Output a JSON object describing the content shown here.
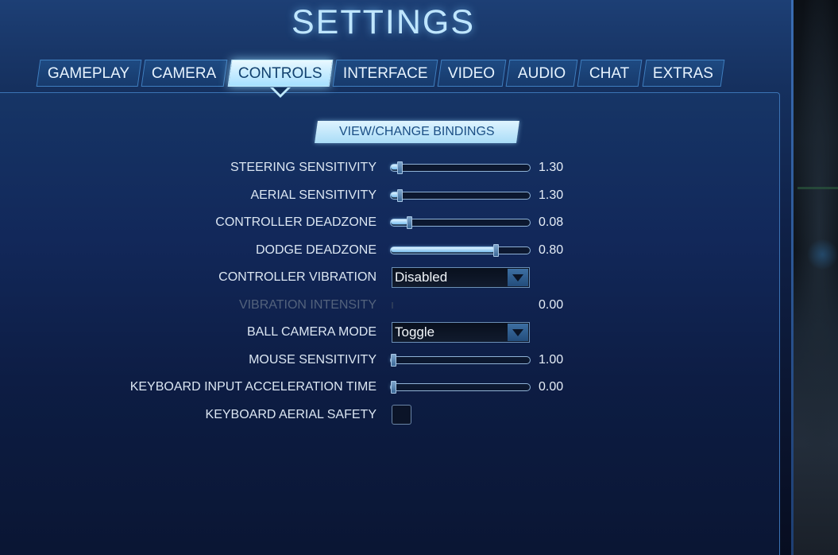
{
  "title": "SETTINGS",
  "tabs": [
    {
      "label": "GAMEPLAY",
      "active": false
    },
    {
      "label": "CAMERA",
      "active": false
    },
    {
      "label": "CONTROLS",
      "active": true
    },
    {
      "label": "INTERFACE",
      "active": false
    },
    {
      "label": "VIDEO",
      "active": false
    },
    {
      "label": "AUDIO",
      "active": false
    },
    {
      "label": "CHAT",
      "active": false
    },
    {
      "label": "EXTRAS",
      "active": false
    }
  ],
  "bindings_button": "VIEW/CHANGE BINDINGS",
  "settings": {
    "steering_sensitivity": {
      "label": "STEERING SENSITIVITY",
      "value": "1.30",
      "fraction": 0.05
    },
    "aerial_sensitivity": {
      "label": "AERIAL SENSITIVITY",
      "value": "1.30",
      "fraction": 0.05
    },
    "controller_deadzone": {
      "label": "CONTROLLER DEADZONE",
      "value": "0.08",
      "fraction": 0.12
    },
    "dodge_deadzone": {
      "label": "DODGE DEADZONE",
      "value": "0.80",
      "fraction": 0.77
    },
    "controller_vibration": {
      "label": "CONTROLLER VIBRATION",
      "selected": "Disabled"
    },
    "vibration_intensity": {
      "label": "VIBRATION INTENSITY",
      "value": "0.00",
      "disabled": true
    },
    "ball_camera_mode": {
      "label": "BALL CAMERA MODE",
      "selected": "Toggle"
    },
    "mouse_sensitivity": {
      "label": "MOUSE SENSITIVITY",
      "value": "1.00",
      "fraction": 0.0
    },
    "keyboard_input_acceleration_time": {
      "label": "KEYBOARD INPUT ACCELERATION TIME",
      "value": "0.00",
      "fraction": 0.0
    },
    "keyboard_aerial_safety": {
      "label": "KEYBOARD AERIAL SAFETY",
      "checked": false
    }
  }
}
